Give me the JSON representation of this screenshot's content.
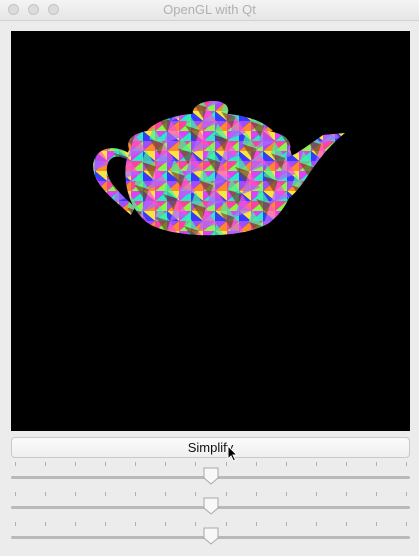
{
  "window": {
    "title": "OpenGL with Qt"
  },
  "controls": {
    "simplify_label": "Simplify"
  },
  "sliders": [
    {
      "value": 0.5
    },
    {
      "value": 0.5
    },
    {
      "value": 0.5
    }
  ]
}
